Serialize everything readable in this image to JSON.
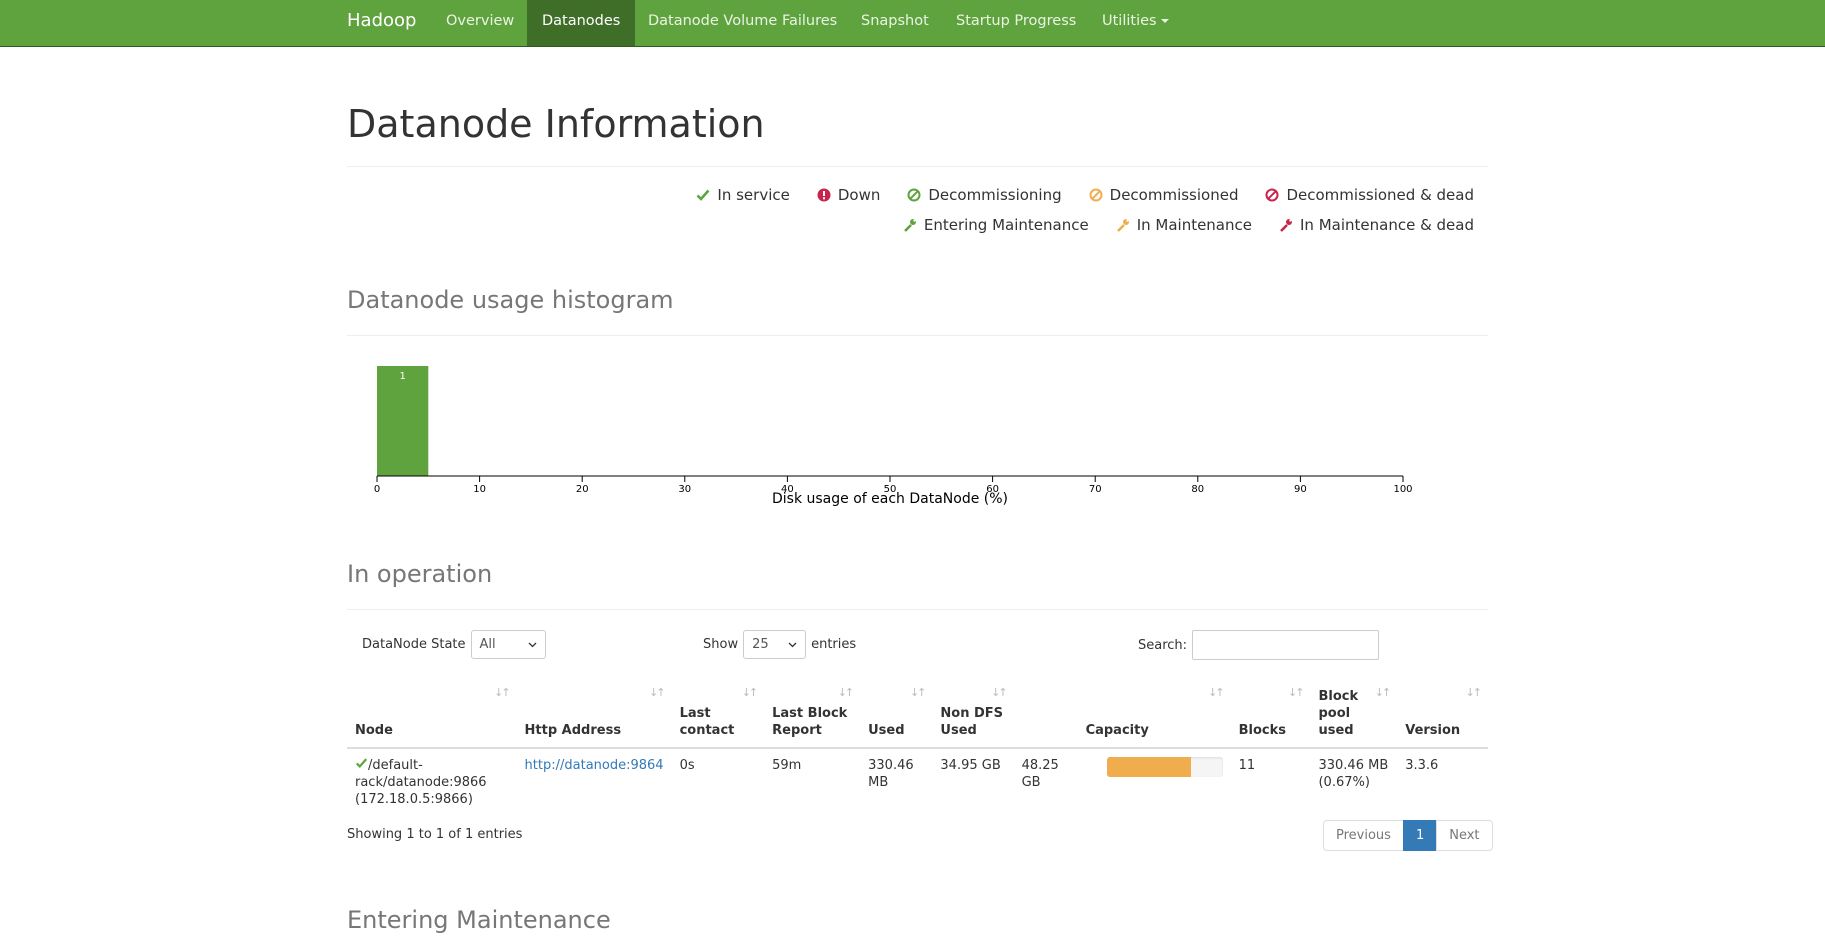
{
  "navbar": {
    "brand": "Hadoop",
    "links": [
      "Overview",
      "Datanodes",
      "Datanode Volume Failures",
      "Snapshot",
      "Startup Progress",
      "Utilities"
    ],
    "active": "Datanodes",
    "color": "#5fa33e"
  },
  "page_title": "Datanode Information",
  "legend": {
    "row1": [
      {
        "label": "In service",
        "icon": "check-icon",
        "color": "#5fa33e"
      },
      {
        "label": "Down",
        "icon": "exclamation-circle-icon",
        "color": "#c7254e"
      },
      {
        "label": "Decommissioning",
        "icon": "ban-icon",
        "color": "#5fa33e"
      },
      {
        "label": "Decommissioned",
        "icon": "ban-icon",
        "color": "#f0ad4e"
      },
      {
        "label": "Decommissioned & dead",
        "icon": "ban-icon",
        "color": "#c7254e"
      }
    ],
    "row2": [
      {
        "label": "Entering Maintenance",
        "icon": "wrench-icon",
        "color": "#5fa33e"
      },
      {
        "label": "In Maintenance",
        "icon": "wrench-icon",
        "color": "#f0ad4e"
      },
      {
        "label": "In Maintenance & dead",
        "icon": "wrench-icon",
        "color": "#c7254e"
      }
    ]
  },
  "histogram": {
    "heading": "Datanode usage histogram",
    "chart_data": {
      "type": "bar",
      "bins": [
        [
          0,
          5
        ]
      ],
      "values": [
        1
      ],
      "xlabel": "Disk usage of each DataNode (%)",
      "xlim": [
        0,
        100
      ],
      "xticks": [
        0,
        10,
        20,
        30,
        40,
        50,
        60,
        70,
        80,
        90,
        100
      ],
      "bar_color": "#5fa33e"
    }
  },
  "in_operation": {
    "heading": "In operation",
    "state_label": "DataNode State",
    "state_value": "All",
    "show_label": "Show",
    "show_value": "25",
    "entries_label": "entries",
    "search_label": "Search:",
    "columns": [
      "Node",
      "Http Address",
      "Last contact",
      "Last Block Report",
      "Used",
      "Non DFS Used",
      "Capacity",
      "Blocks",
      "Block pool used",
      "Version"
    ],
    "rows": [
      {
        "node": "/default-rack/datanode:9866 (172.18.0.5:9866)",
        "http": "http://datanode:9864",
        "last_contact": "0s",
        "last_block_report": "59m",
        "used": "330.46 MB",
        "non_dfs_used": "34.95 GB",
        "capacity": "48.25 GB",
        "capacity_used_fraction": 0.73,
        "blocks": "11",
        "block_pool_used": "330.46 MB (0.67%)",
        "version": "3.3.6"
      }
    ],
    "showing": "Showing 1 to 1 of 1 entries",
    "pager": {
      "prev": "Previous",
      "page": "1",
      "next": "Next"
    }
  },
  "entering_maintenance": {
    "heading": "Entering Maintenance"
  }
}
